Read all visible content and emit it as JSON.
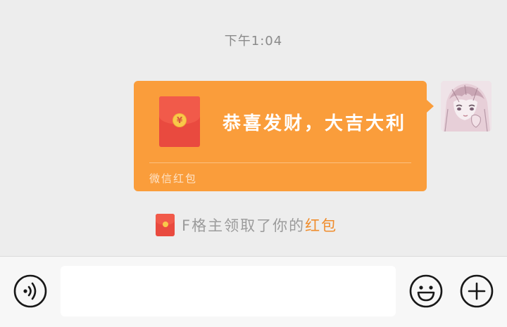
{
  "chat": {
    "timestamp": "下午1:04",
    "red_packet": {
      "greeting": "恭喜发财，大吉大利",
      "footer_label": "微信红包",
      "coin_symbol": "¥",
      "bubble_color": "#fa9d3b",
      "envelope_color": "#e94a3f"
    },
    "avatar": {
      "icon": "anime-girl-avatar-icon"
    },
    "notice": {
      "text": "F格主领取了你的",
      "link_text": "红包",
      "link_color": "#f08c2b"
    }
  },
  "input_bar": {
    "voice_icon": "voice-input-icon",
    "message_value": "",
    "emoji_icon": "emoji-icon",
    "more_icon": "plus-circle-icon"
  }
}
